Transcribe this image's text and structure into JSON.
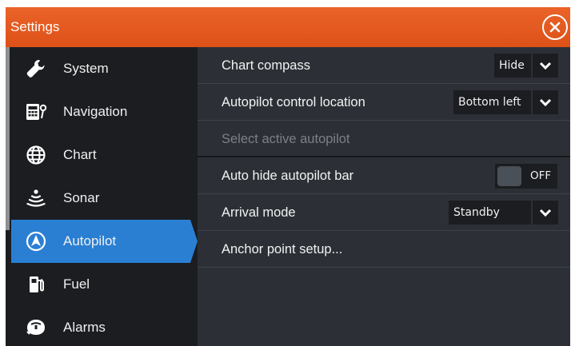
{
  "window": {
    "title": "Settings",
    "accent_color": "#e35a1f"
  },
  "sidebar": {
    "items": [
      {
        "label": "System",
        "icon": "wrench-icon",
        "active": false
      },
      {
        "label": "Navigation",
        "icon": "navigation-icon",
        "active": false
      },
      {
        "label": "Chart",
        "icon": "globe-icon",
        "active": false
      },
      {
        "label": "Sonar",
        "icon": "sonar-icon",
        "active": false
      },
      {
        "label": "Autopilot",
        "icon": "autopilot-icon",
        "active": true
      },
      {
        "label": "Fuel",
        "icon": "fuel-icon",
        "active": false
      },
      {
        "label": "Alarms",
        "icon": "alarm-icon",
        "active": false
      }
    ],
    "active_color": "#2a7fd3"
  },
  "content": {
    "rows": [
      {
        "label": "Chart compass",
        "control": "dropdown",
        "value": "Hide"
      },
      {
        "label": "Autopilot control location",
        "control": "dropdown",
        "value": "Bottom left"
      },
      {
        "label": "Select active autopilot",
        "control": "none",
        "disabled": true
      },
      {
        "label": "Auto hide autopilot bar",
        "control": "toggle",
        "value": "OFF"
      },
      {
        "label": "Arrival mode",
        "control": "dropdown",
        "value": "Standby"
      },
      {
        "label": "Anchor point setup...",
        "control": "none"
      }
    ]
  }
}
